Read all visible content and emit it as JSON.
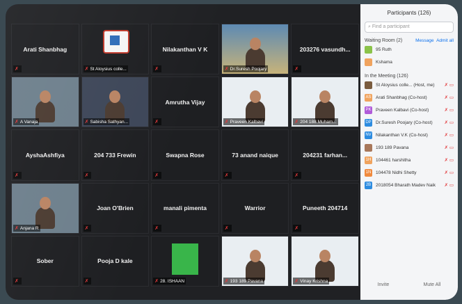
{
  "tiles": [
    {
      "name": "Arati Shanbhag",
      "label": ""
    },
    {
      "name": "",
      "label": "St Aloysius colle..."
    },
    {
      "name": "Nilakanthan V K",
      "label": ""
    },
    {
      "name": "",
      "label": "Dr.Suresh Poojary"
    },
    {
      "name": "203276 vasundh...",
      "label": ""
    },
    {
      "name": "",
      "label": "A Vanaja"
    },
    {
      "name": "",
      "label": "Sabisha Sathyan..."
    },
    {
      "name": "Amrutha Vijay",
      "label": ""
    },
    {
      "name": "",
      "label": "Praveen Kalbavi"
    },
    {
      "name": "",
      "label": "204 188 Muham..."
    },
    {
      "name": "AyshaAshfiya",
      "label": ""
    },
    {
      "name": "204 733 Frewin",
      "label": ""
    },
    {
      "name": "Swapna Rose",
      "label": ""
    },
    {
      "name": "73 anand naique",
      "label": ""
    },
    {
      "name": "204231 farhan...",
      "label": ""
    },
    {
      "name": "",
      "label": "Anjana R"
    },
    {
      "name": "Joan O'Brien",
      "label": ""
    },
    {
      "name": "manali pimenta",
      "label": ""
    },
    {
      "name": "Warrior",
      "label": ""
    },
    {
      "name": "Puneeth 204714",
      "label": ""
    },
    {
      "name": "Sober",
      "label": ""
    },
    {
      "name": "Pooja D kale",
      "label": ""
    },
    {
      "name": "",
      "label": "28. ISHAAN"
    },
    {
      "name": "",
      "label": "193 189 Pavana"
    },
    {
      "name": "",
      "label": "Vinay Krishna"
    }
  ],
  "panel": {
    "title": "Participants (126)",
    "search_placeholder": "Find a participant",
    "waiting_header": "Waiting Room (2)",
    "message": "Message",
    "admit_all": "Admit all",
    "waiting": [
      {
        "initials": "",
        "name": "95 Ruth",
        "color": "#8bc34a"
      },
      {
        "initials": "",
        "name": "Kshama",
        "color": "#f0a35e"
      }
    ],
    "meeting_header": "In the Meeting (126)",
    "members": [
      {
        "initials": "",
        "name": "St Aloysius colle... (Host, me)",
        "color": "#7a5c3f"
      },
      {
        "initials": "AS",
        "name": "Arati Shanbhag (Co-host)",
        "color": "#f0a35e"
      },
      {
        "initials": "PK",
        "name": "Praveen Kalbavi (Co-host)",
        "color": "#b05bd9"
      },
      {
        "initials": "DP",
        "name": "Dr.Suresh Poojary (Co-host)",
        "color": "#2d8ce0"
      },
      {
        "initials": "NV",
        "name": "Nilakanthan V.K (Co-host)",
        "color": "#2d8ce0"
      },
      {
        "initials": "",
        "name": "193 189 Pavana",
        "color": "#a8775a"
      },
      {
        "initials": "1H",
        "name": "104461 harshitha",
        "color": "#f0a35e"
      },
      {
        "initials": "1N",
        "name": "104478 Nidhi Shetty",
        "color": "#f08a3e"
      },
      {
        "initials": "2B",
        "name": "2018054 Bharath Madev Naik",
        "color": "#2d8ce0"
      }
    ],
    "invite": "Invite",
    "mute_all": "Mute All"
  }
}
